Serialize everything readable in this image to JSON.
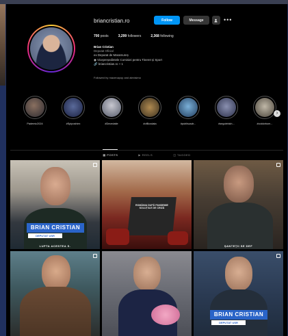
{
  "profile": {
    "username": "briancristian.ro",
    "follow_label": "Follow",
    "message_label": "Message",
    "more": "•••",
    "stats": [
      {
        "value": "700",
        "label": "posts"
      },
      {
        "value": "3,299",
        "label": "followers"
      },
      {
        "value": "2,368",
        "label": "following"
      }
    ],
    "bio": {
      "name": "Brian Cristian",
      "category": "Deputat Oficial",
      "line1": "ex Deputat de Maramureș",
      "line2": "Vicepreședintele Comisiei pentru Tineret și Sport",
      "link": "briancristian.ro + 1"
    },
    "followed_by": "Followed by macenapop and alexisimo"
  },
  "highlights": [
    {
      "label": "Pademic2024"
    },
    {
      "label": "#Spiposhlex"
    },
    {
      "label": "#Decedatie"
    },
    {
      "label": "#ofBoxdata"
    },
    {
      "label": "#publisusdr..."
    },
    {
      "label": "#segolebich..."
    },
    {
      "label": "#coldorbom..."
    }
  ],
  "tabs": [
    "POSTS",
    "REELS",
    "TAGGED"
  ],
  "posts": [
    {
      "caption": "BRIAN CRISTIAN",
      "sub": "DEPUTAT USR",
      "footer": "LUPTA ACESTEA S."
    },
    {
      "caption": "",
      "sub": "",
      "footer": "ROMÂNIA DUPĂ PANDEMIE SOLUȚIILE DE CRIZĂ"
    },
    {
      "caption": "",
      "sub": "",
      "footer": "ȘANTEȚII SE DEF"
    },
    {
      "caption": "",
      "sub": "",
      "footer": ""
    },
    {
      "caption": "",
      "sub": "",
      "footer": ""
    },
    {
      "caption": "BRIAN CRISTIAN",
      "sub": "DEPUTAT USR",
      "footer": ""
    }
  ],
  "colors": {
    "follow": "#0095f6",
    "caption_blue": "#2a64c8",
    "panel_bg": "#000000"
  }
}
